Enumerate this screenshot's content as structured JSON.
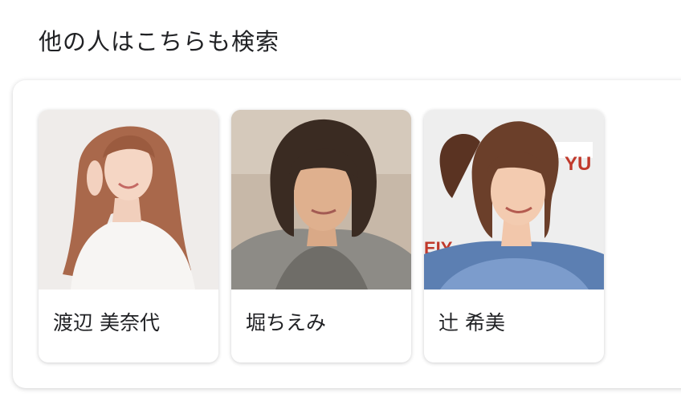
{
  "section": {
    "title": "他の人はこちらも検索"
  },
  "people": [
    {
      "name": "渡辺 美奈代"
    },
    {
      "name": "堀ちえみ"
    },
    {
      "name": "辻 希美"
    }
  ],
  "colors": {
    "text": "#202124",
    "panel_background": "#ffffff"
  }
}
